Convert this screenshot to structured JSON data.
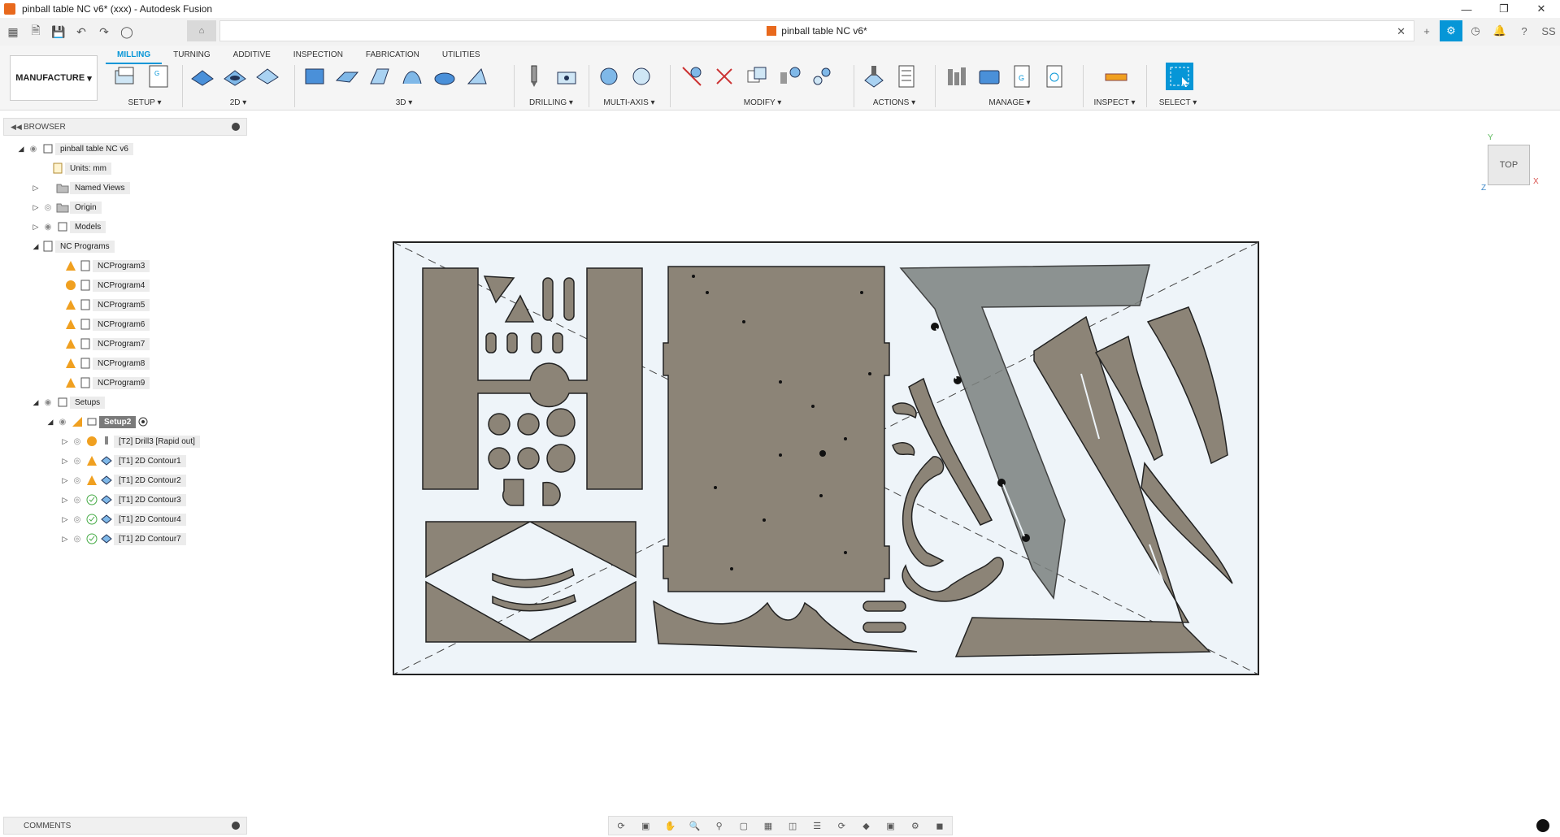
{
  "window": {
    "title": "pinball table NC v6* (xxx) - Autodesk Fusion",
    "controls": [
      "minimize-icon",
      "restore-icon",
      "close-icon"
    ]
  },
  "doc_tab": {
    "title": "pinball table NC v6*"
  },
  "user_initials": "SS",
  "ribbon": {
    "workspace": "MANUFACTURE",
    "tabs": [
      "MILLING",
      "TURNING",
      "ADDITIVE",
      "INSPECTION",
      "FABRICATION",
      "UTILITIES"
    ],
    "active_tab": "MILLING",
    "groups": [
      "SETUP",
      "2D",
      "3D",
      "DRILLING",
      "MULTI-AXIS",
      "MODIFY",
      "ACTIONS",
      "MANAGE",
      "INSPECT",
      "SELECT"
    ]
  },
  "browser": {
    "header": "BROWSER",
    "root": "pinball table NC v6",
    "units": "Units: mm",
    "items": {
      "named_views": "Named Views",
      "origin": "Origin",
      "models": "Models",
      "nc_programs": "NC Programs",
      "setups": "Setups",
      "setup2": "Setup2"
    },
    "programs": [
      "NCProgram3",
      "NCProgram4",
      "NCProgram5",
      "NCProgram6",
      "NCProgram7",
      "NCProgram8",
      "NCProgram9"
    ],
    "operations": [
      "[T2] Drill3 [Rapid out]",
      "[T1] 2D Contour1",
      "[T1] 2D Contour2",
      "[T1] 2D Contour3",
      "[T1] 2D Contour4",
      "[T1] 2D Contour7"
    ]
  },
  "viewcube": {
    "face": "TOP",
    "axis_x": "X",
    "axis_y": "Y",
    "axis_z": "Z"
  },
  "comments": {
    "header": "COMMENTS"
  },
  "colors": {
    "accent": "#0696d7",
    "part_fill": "#8c8477",
    "stock_fill": "#eef4f9",
    "warning": "#f0a020"
  }
}
